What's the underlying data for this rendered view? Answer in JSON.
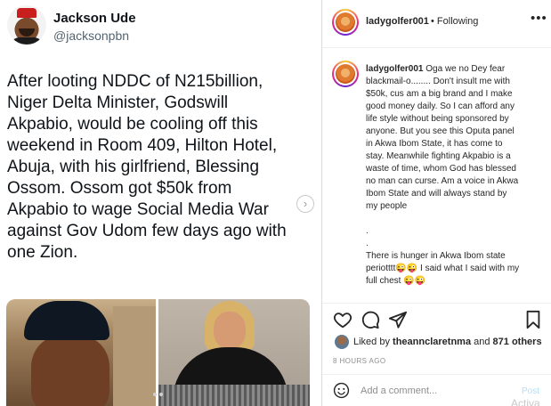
{
  "tweet": {
    "author_name": "Jackson Ude",
    "author_handle": "@jacksonpbn",
    "lines": [
      "After looting NDDC of N215billion,",
      "Niger Delta Minister, Godswill",
      "Akpabio, would be cooling off this",
      "weekend in Room 409, Hilton Hotel,",
      "Abuja, with his girlfriend, Blessing",
      "Ossom. Ossom got $50k from",
      "Akpabio to wage Social Media War",
      "against Gov Udom few days ago with",
      "one Zion."
    ],
    "next_arrow": "›",
    "images": [
      "photo-of-man-in-cap",
      "photo-of-woman-in-black-dress"
    ]
  },
  "instagram": {
    "username": "ladygolfer001",
    "following_text": "• Following",
    "more": "•••",
    "caption_user": "ladygolfer001",
    "caption_lines": [
      "Oga we no Dey fear",
      "blackmail-o........ Don't insult me with",
      "$50k, cus am a big brand and I make",
      "good money daily. So I can afford any",
      "life style without being sponsored by",
      "anyone. But you see this Oputa panel",
      "in Akwa Ibom State, it has come to",
      "stay. Meanwhile fighting Akpabio is a",
      "waste of time, whom God has blessed",
      "no man can curse. Am a voice in Akwa",
      "Ibom State and will always stand by",
      "my people"
    ],
    "caption_dot1": ".",
    "caption_dot2": ".",
    "caption_tail": [
      "There is hunger in Akwa Ibom state",
      "periotttt😜😜 I said what I said with my",
      "full chest 😜😜"
    ],
    "likes_prefix": "Liked by ",
    "likes_user": "theannclaretnma",
    "likes_mid": " and ",
    "likes_count": "871 others",
    "time_ago": "8 HOURS AGO",
    "comment_placeholder": "Add a comment...",
    "post_label": "Post",
    "watermark": "Activa",
    "icons": [
      "heart-icon",
      "comment-icon",
      "share-icon",
      "bookmark-icon",
      "emoji-icon"
    ],
    "colors": {
      "post_disabled": "#b2dffc",
      "muted": "#8e8e8e"
    }
  }
}
